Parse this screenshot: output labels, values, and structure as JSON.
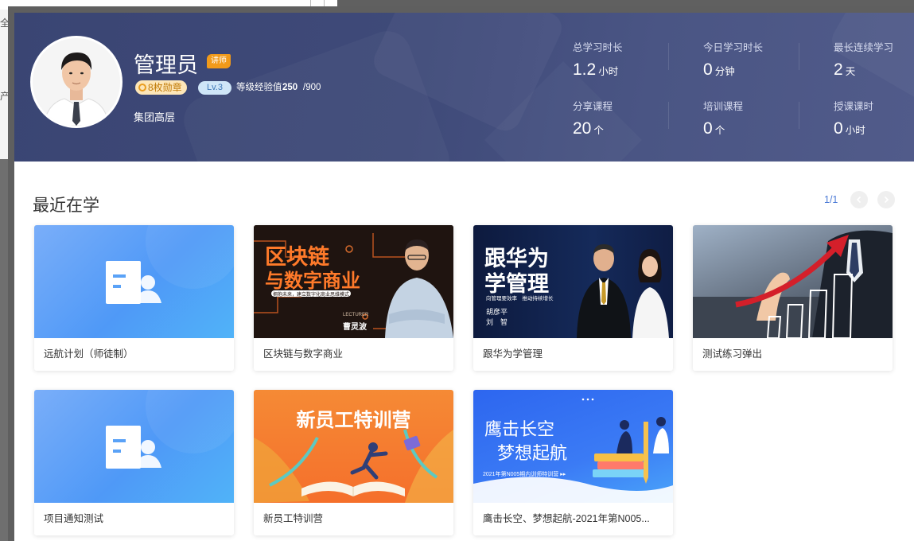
{
  "background": {
    "left_text_1": "全部",
    "left_text_2": "产"
  },
  "profile": {
    "name": "管理员",
    "role_badge": "讲师",
    "medals": "8枚勋章",
    "level": "Lv.3",
    "exp_label": "等级经验值",
    "exp_current": "250",
    "exp_max": "/900",
    "department": "集团高层"
  },
  "stats": [
    {
      "label": "总学习时长",
      "value": "1.2",
      "unit": "小时"
    },
    {
      "label": "今日学习时长",
      "value": "0",
      "unit": "分钟"
    },
    {
      "label": "最长连续学习",
      "value": "2",
      "unit": "天"
    },
    {
      "label": "分享课程",
      "value": "20",
      "unit": "个"
    },
    {
      "label": "培训课程",
      "value": "0",
      "unit": "个"
    },
    {
      "label": "授课课时",
      "value": "0",
      "unit": "小时"
    }
  ],
  "recent": {
    "title": "最近在学",
    "pager": "1/1"
  },
  "courses": [
    {
      "title": "远航计划（师徒制）",
      "thumb": "default-doc-icon"
    },
    {
      "title": "区块链与数字商业",
      "thumb": "blockchain-cover",
      "cover_title_1": "区块链",
      "cover_title_2": "与数字商业",
      "cover_banner": "拥抱未来，建立数字化商业思维模式",
      "cover_name": "曹灵波",
      "cover_name_label": "LECTURER"
    },
    {
      "title": "跟华为学管理",
      "thumb": "huawei-cover",
      "cover_title_1": "跟华为",
      "cover_title_2": "学管理",
      "cover_tag": "向管理要效率　推动持续增长",
      "cover_name_1": "胡彦平",
      "cover_name_2": "刘　智"
    },
    {
      "title": "测试练习弹出",
      "thumb": "growth-chart-photo"
    },
    {
      "title": "项目通知测试",
      "thumb": "default-doc-icon"
    },
    {
      "title": "新员工特训营",
      "thumb": "new-staff-cover",
      "cover_title": "新员工特训营"
    },
    {
      "title": "鹰击长空、梦想起航-2021年第N005...",
      "thumb": "eagle-cover",
      "cover_title_1": "鹰击长空",
      "cover_title_2": "梦想起航",
      "cover_sub": "2021年第N005期内训师特训营 ▸▸"
    }
  ],
  "colors": {
    "header_bg": "#3f4a79",
    "role_badge": "#f19a1a",
    "pager_accent": "#4b7ad6",
    "default_thumb": "#4f99f7"
  }
}
